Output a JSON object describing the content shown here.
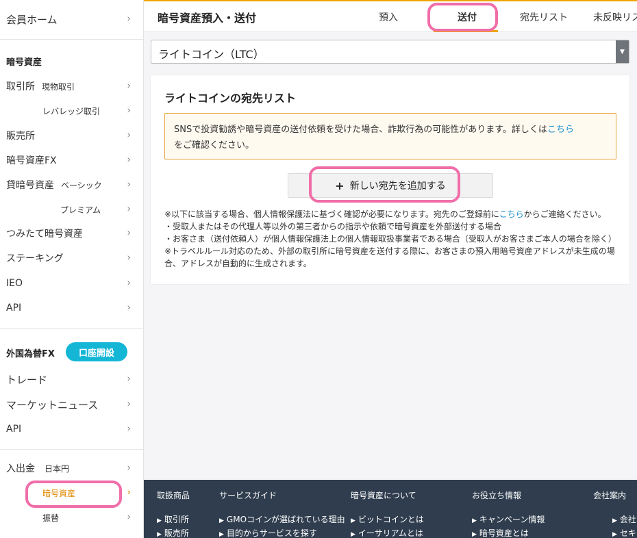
{
  "sidebar": {
    "member_home": "会員ホーム",
    "crypto_section": "暗号資産",
    "exchange": "取引所",
    "spot": "現物取引",
    "leverage": "レバレッジ取引",
    "sales": "販売所",
    "crypto_fx": "暗号資産FX",
    "lending": "貸暗号資産",
    "basic": "ベーシック",
    "premium": "プレミアム",
    "tsumitate": "つみたて暗号資産",
    "staking": "ステーキング",
    "ieo": "IEO",
    "api": "API",
    "forex_section": "外国為替FX",
    "open_account": "口座開設",
    "trade": "トレード",
    "market_news": "マーケットニュース",
    "api2": "API",
    "deposit": "入出金",
    "jpy": "日本円",
    "crypto_asset": "暗号資産",
    "transfer": "振替"
  },
  "header": {
    "title": "暗号資産預入・送付",
    "tabs": [
      "預入",
      "送付",
      "宛先リスト",
      "未反映リスト"
    ]
  },
  "select": {
    "value": "ライトコイン（LTC）"
  },
  "card": {
    "title": "ライトコインの宛先リスト",
    "warning_text": "SNSで投資勧誘や暗号資産の送付依頼を受けた場合、詐欺行為の可能性があります。詳しくは",
    "warning_link": "こちら",
    "warning_tail": "をご確認ください。",
    "add_button": "新しい宛先を追加する",
    "note1_pre": "※以下に該当する場合、個人情報保護法に基づく確認が必要になります。宛先のご登録前に",
    "note1_link": "こちら",
    "note1_post": "からご連絡ください。",
    "note2": "・受取人またはその代理人等以外の第三者からの指示や依頼で暗号資産を外部送付する場合",
    "note3": "・お客さま（送付依頼人）が個人情報保護法上の個人情報取扱事業者である場合（受取人がお客さまご本人の場合を除く）",
    "note4": "※トラベルルール対応のため、外部の取引所に暗号資産を送付する際に、お客さまの預入用暗号資産アドレスが未生成の場合、アドレスが自動的に生成されます。"
  },
  "footer": {
    "headings": [
      "取扱商品",
      "サービスガイド",
      "暗号資産について",
      "お役立ち情報",
      "会社案内"
    ],
    "links": {
      "products": [
        "取引所",
        "販売所"
      ],
      "guide": [
        "GMOコインが選ばれている理由",
        "目的からサービスを探す"
      ],
      "about": [
        "ビットコインとは",
        "イーサリアムとは"
      ],
      "info": [
        "キャンペーン情報",
        "暗号資産とは"
      ],
      "company": [
        "会社",
        "セキ"
      ]
    }
  },
  "colors": {
    "accent": "#f0a500",
    "highlight": "#f06ea9",
    "link": "#1a8fd0",
    "button_teal": "#14b6d6",
    "footer_bg": "#2f3d4e"
  }
}
